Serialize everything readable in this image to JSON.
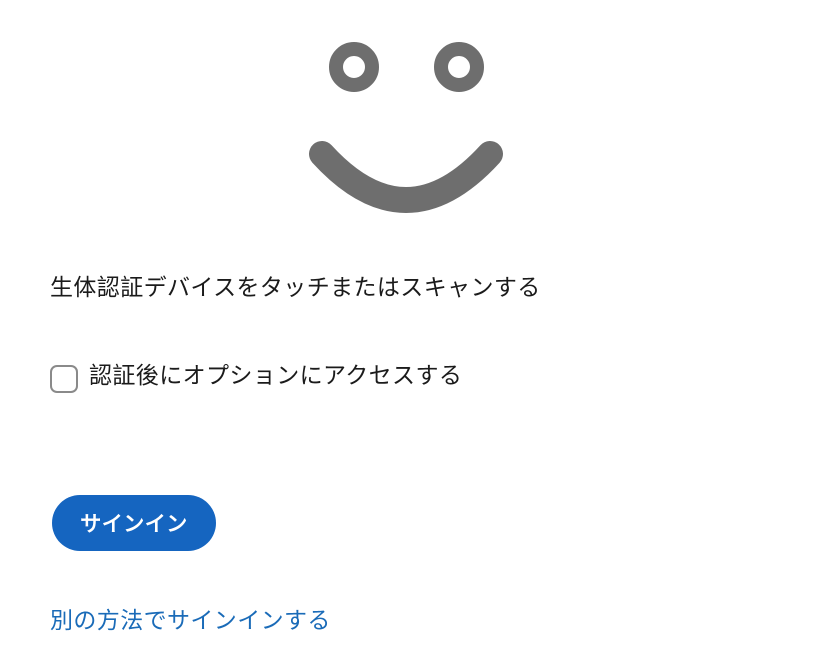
{
  "header": {
    "icon": "smiley-face-icon",
    "icon_color": "#6e6e6e"
  },
  "main": {
    "instruction": "生体認証デバイスをタッチまたはスキャンする",
    "option": {
      "label": "認証後にオプションにアクセスする",
      "checked": false
    },
    "signin_label": "サインイン",
    "alt_signin_link": "別の方法でサインインする"
  },
  "colors": {
    "primary": "#1565c0",
    "link": "#1a6bb8",
    "text": "#1b1b1b"
  }
}
